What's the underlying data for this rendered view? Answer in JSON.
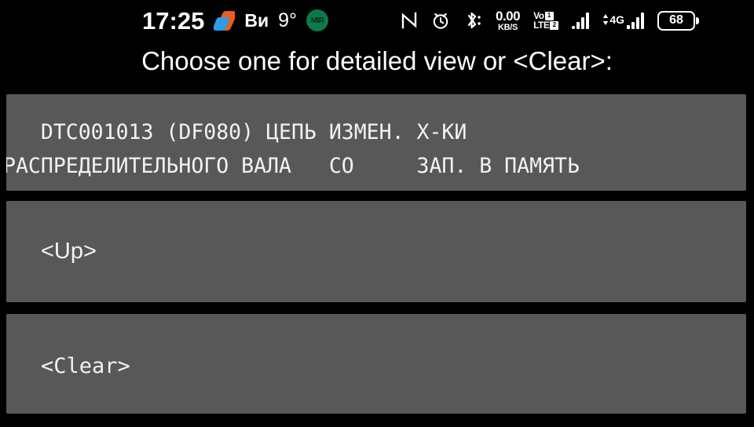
{
  "statusbar": {
    "time": "17:25",
    "app_icon": "bank-app-icon",
    "weather_label": "Ви",
    "temperature": "9°",
    "mir_badge": "MIR",
    "nfc_icon": "nfc-icon",
    "alarm_icon": "alarm-icon",
    "bluetooth_icon": "bluetooth-icon",
    "network_speed_value": "0.00",
    "network_speed_unit": "KB/S",
    "volte_vo": "Vo",
    "volte_lte": "LTE",
    "sim1": "1",
    "sim2": "2",
    "network_type": "4G",
    "battery_level": "68",
    "colors": {
      "background": "#000000",
      "text": "#ffffff",
      "mir_green": "#0b7a4b",
      "app_orange": "#f05a1e",
      "app_blue": "#2f9ae8"
    }
  },
  "prompt": {
    "title": "Choose one for detailed view or <Clear>:"
  },
  "list": {
    "colors": {
      "card_background": "#585858",
      "card_text": "#f2f2f2"
    },
    "items": [
      {
        "name": "dtc-entry",
        "line1": "   DTC001013 (DF080) ЦЕПЬ ИЗМЕН. Х-КИ",
        "line2": "РАСПРЕДЕЛИТЕЛЬНОГО ВАЛА   СО     ЗАП. В ПАМЯТЬ"
      },
      {
        "name": "up-entry",
        "label": "<Up>"
      },
      {
        "name": "clear-entry",
        "label": "<Clear>"
      }
    ]
  }
}
